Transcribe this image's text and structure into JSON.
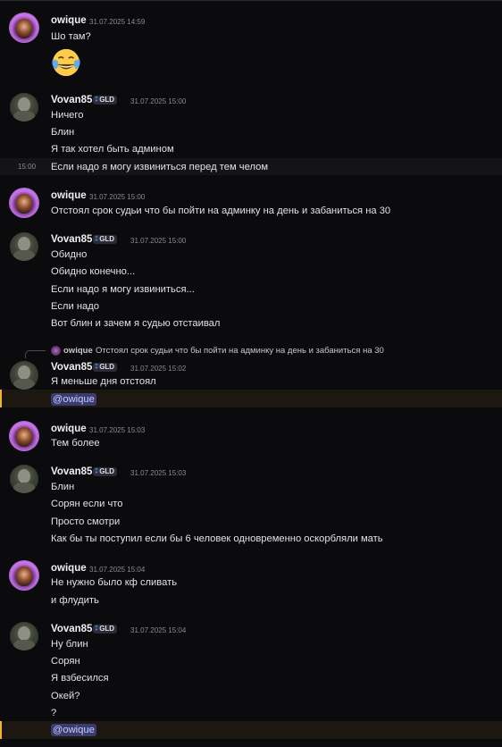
{
  "colors": {
    "background": "#0b0b0d",
    "mention_bg": "#3a3c6e",
    "mention_text": "#c9cdfb",
    "mention_highlight": "#1c1710",
    "mention_bar": "#f0b232",
    "guild_tag_icon": "#4b8cf0"
  },
  "messages": [
    {
      "author": "owique",
      "timestamp": "31.07.2025 14:59",
      "lines": [
        "Шо там?"
      ],
      "emoji": "face-with-tears-of-joy"
    },
    {
      "author": "Vovan85",
      "tag": "GLD",
      "timestamp": "31.07.2025 15:00",
      "lines": [
        "Ничего",
        "Блин",
        "Я так хотел быть админом",
        "Если надо я могу извиниться перед тем челом"
      ],
      "hover_time": "15:00"
    },
    {
      "author": "owique",
      "timestamp": "31.07.2025 15:00",
      "lines": [
        "Отстоял срок судьи что бы пойти на админку на день и забаниться на 30"
      ]
    },
    {
      "author": "Vovan85",
      "tag": "GLD",
      "timestamp": "31.07.2025 15:00",
      "lines": [
        "Обидно",
        "Обидно конечно...",
        "Если надо я могу извиниться...",
        "Если надо",
        "Вот блин и зачем я судью отстаивал"
      ]
    },
    {
      "reply": {
        "author": "owique",
        "text": "Отстоял срок судьи что бы пойти на админку на день и забаниться на 30"
      },
      "author": "Vovan85",
      "tag": "GLD",
      "timestamp": "31.07.2025 15:02",
      "lines": [
        "Я меньше дня отстоял"
      ],
      "mention": "@owique"
    },
    {
      "author": "owique",
      "timestamp": "31.07.2025 15:03",
      "lines": [
        "Тем более"
      ]
    },
    {
      "author": "Vovan85",
      "tag": "GLD",
      "timestamp": "31.07.2025 15:03",
      "lines": [
        "Блин",
        "Сорян если что",
        "Просто смотри",
        "Как бы ты поступил если бы 6 человек одновременно оскорбляли мать"
      ]
    },
    {
      "author": "owique",
      "timestamp": "31.07.2025 15:04",
      "lines": [
        "Не нужно было кф сливать",
        "и флудить"
      ]
    },
    {
      "author": "Vovan85",
      "tag": "GLD",
      "timestamp": "31.07.2025 15:04",
      "lines": [
        "Ну блин",
        "Сорян",
        "Я взбесился",
        "Окей?",
        "?"
      ],
      "mention": "@owique"
    }
  ]
}
